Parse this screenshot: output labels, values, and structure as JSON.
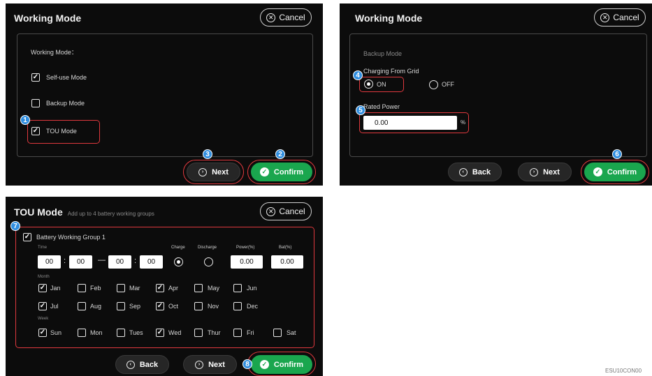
{
  "accent_green": "#1aa64e",
  "highlight_red": "#e0393e",
  "badge_blue": "#2f8ee0",
  "panel1": {
    "title": "Working Mode",
    "cancel_label": "Cancel",
    "section_label": "Working Mode：",
    "options": [
      {
        "label": "Self-use Mode",
        "checked": true
      },
      {
        "label": "Backup Mode",
        "checked": false
      },
      {
        "label": "TOU Mode",
        "checked": true
      }
    ],
    "next_label": "Next",
    "confirm_label": "Confirm",
    "badges": [
      "1",
      "2",
      "3"
    ]
  },
  "panel2": {
    "title": "Working Mode",
    "cancel_label": "Cancel",
    "mode_label": "Backup Mode",
    "charging_label": "Charging From Grid",
    "on_label": "ON",
    "off_label": "OFF",
    "rated_power_label": "Rated Power",
    "rated_power_value": "0.00",
    "unit": "%",
    "back_label": "Back",
    "next_label": "Next",
    "confirm_label": "Confirm",
    "badges": [
      "4",
      "5",
      "6"
    ]
  },
  "panel3": {
    "title": "TOU Mode",
    "subtitle": "Add up to 4 battery working groups",
    "cancel_label": "Cancel",
    "group_label": "Battery Working Group 1",
    "time_label": "Time",
    "time_values": [
      "00",
      "00",
      "00",
      "00"
    ],
    "charge_label": "Charge",
    "discharge_label": "Discharge",
    "power_label": "Power(%)",
    "bat_label": "Bat(%)",
    "power_value": "0.00",
    "bat_value": "0.00",
    "month_label": "Month",
    "months": [
      {
        "label": "Jan",
        "checked": true
      },
      {
        "label": "Feb",
        "checked": false
      },
      {
        "label": "Mar",
        "checked": false
      },
      {
        "label": "Apr",
        "checked": true
      },
      {
        "label": "May",
        "checked": false
      },
      {
        "label": "Jun",
        "checked": false
      },
      {
        "label": "Jul",
        "checked": true
      },
      {
        "label": "Aug",
        "checked": false
      },
      {
        "label": "Sep",
        "checked": false
      },
      {
        "label": "Oct",
        "checked": true
      },
      {
        "label": "Nov",
        "checked": false
      },
      {
        "label": "Dec",
        "checked": false
      }
    ],
    "week_label": "Week",
    "weekdays": [
      {
        "label": "Sun",
        "checked": true
      },
      {
        "label": "Mon",
        "checked": false
      },
      {
        "label": "Tues",
        "checked": false
      },
      {
        "label": "Wed",
        "checked": true
      },
      {
        "label": "Thur",
        "checked": false
      },
      {
        "label": "Fri",
        "checked": false
      },
      {
        "label": "Sat",
        "checked": false
      }
    ],
    "back_label": "Back",
    "next_label": "Next",
    "confirm_label": "Confirm",
    "badges": [
      "7",
      "8"
    ]
  },
  "footer_code": "ESU10CON00"
}
